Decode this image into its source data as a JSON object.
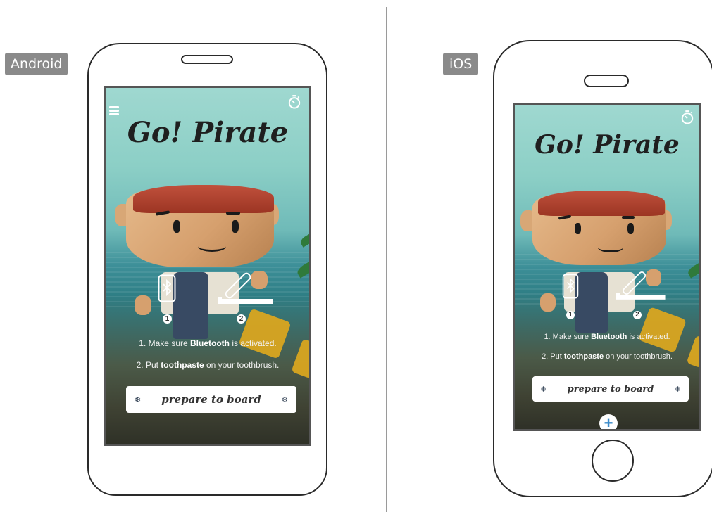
{
  "platforms": {
    "android": "Android",
    "ios": "iOS"
  },
  "app": {
    "title": "Go! Pirate",
    "steps": {
      "n1": "1",
      "n2": "2",
      "line1_pre": "1. Make sure ",
      "line1_bold": "Bluetooth",
      "line1_post": " is activated.",
      "line2_pre": "2. Put ",
      "line2_bold": "toothpaste",
      "line2_post": " on your toothbrush."
    },
    "board_button": "prepare to board",
    "plus_label": "+"
  },
  "icons": [
    "menu-icon",
    "stopwatch-icon",
    "bluetooth-phone-icon",
    "toothbrush-icon",
    "gear-icon",
    "plus-icon"
  ],
  "colors": {
    "tag_bg": "#8a8a8a",
    "frame": "#2a2a2a",
    "sky": "#9fd8d0",
    "sea": "#2f7f86",
    "button": "#ffffff"
  }
}
